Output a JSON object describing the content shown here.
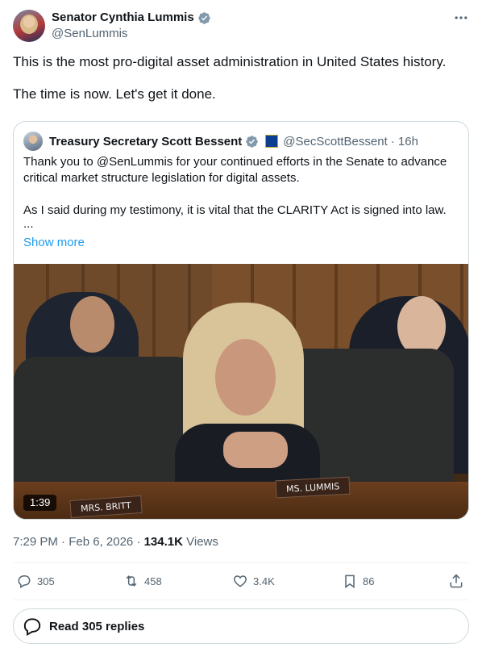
{
  "author": {
    "display_name": "Senator Cynthia Lummis",
    "handle": "@SenLummis",
    "verified": true
  },
  "tweet": {
    "paragraphs": [
      "This is the most pro-digital asset administration in United States history.",
      "The time is now. Let's get it done."
    ]
  },
  "quoted_tweet": {
    "display_name": "Treasury Secretary Scott Bessent",
    "handle": "@SecScottBessent",
    "time": "· 16h",
    "paragraphs": [
      "Thank you to @SenLummis for your continued efforts in the Senate to advance critical market structure legislation for digital assets.",
      "As I said during my testimony, it is vital that the CLARITY Act is signed into law."
    ],
    "ellipsis": "...",
    "show_more": "Show more",
    "video": {
      "duration": "1:39",
      "nameplate_left": "MRS. BRITT",
      "nameplate_right": "MS. LUMMIS"
    }
  },
  "meta": {
    "timestamp": "7:29 PM · Feb 6, 2026 ·",
    "views_count": "134.1K",
    "views_label": "Views"
  },
  "actions": {
    "replies": "305",
    "reposts": "458",
    "likes": "3.4K",
    "bookmarks": "86"
  },
  "read_replies": "Read 305 replies",
  "colors": {
    "text": "#0f1419",
    "secondary": "#536471",
    "link": "#1d9bf0",
    "border": "#cfd9de",
    "verified": "#829aab"
  }
}
